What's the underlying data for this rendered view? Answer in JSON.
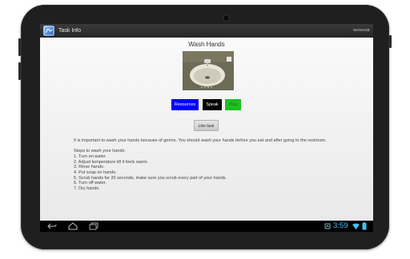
{
  "app": {
    "title": "Task Info",
    "manage_label": "MANAGE"
  },
  "task": {
    "title": "Wash Hands",
    "image_icon": "sink-photo",
    "buttons": {
      "resources": "Resources",
      "speak": "Speak",
      "play": "Play"
    },
    "like_button": "Like task",
    "intro": "It is important to wash your hands because of germs. You should wash your hands before you eat and after going to the restroom.",
    "steps_title": "Steps to wash your hands:",
    "steps": [
      "1. Turn on water.",
      "2. Adjust temperature till it feels warm.",
      "3. Rinse hands.",
      "4. Put soap on hands.",
      "5. Scrub hands for 20 seconds, make sure you scrub every part of your hands.",
      "6. Turn off water.",
      "7. Dry hands."
    ]
  },
  "system": {
    "time": "3:59",
    "nav_icons": [
      "back-icon",
      "home-icon",
      "recent-apps-icon"
    ],
    "status_icons": [
      "notification-icon",
      "wifi-icon",
      "battery-icon"
    ]
  },
  "colors": {
    "resources_button": "#0000ff",
    "speak_button": "#000000",
    "play_button": "#1fc01f",
    "clock": "#3fc1f2"
  }
}
